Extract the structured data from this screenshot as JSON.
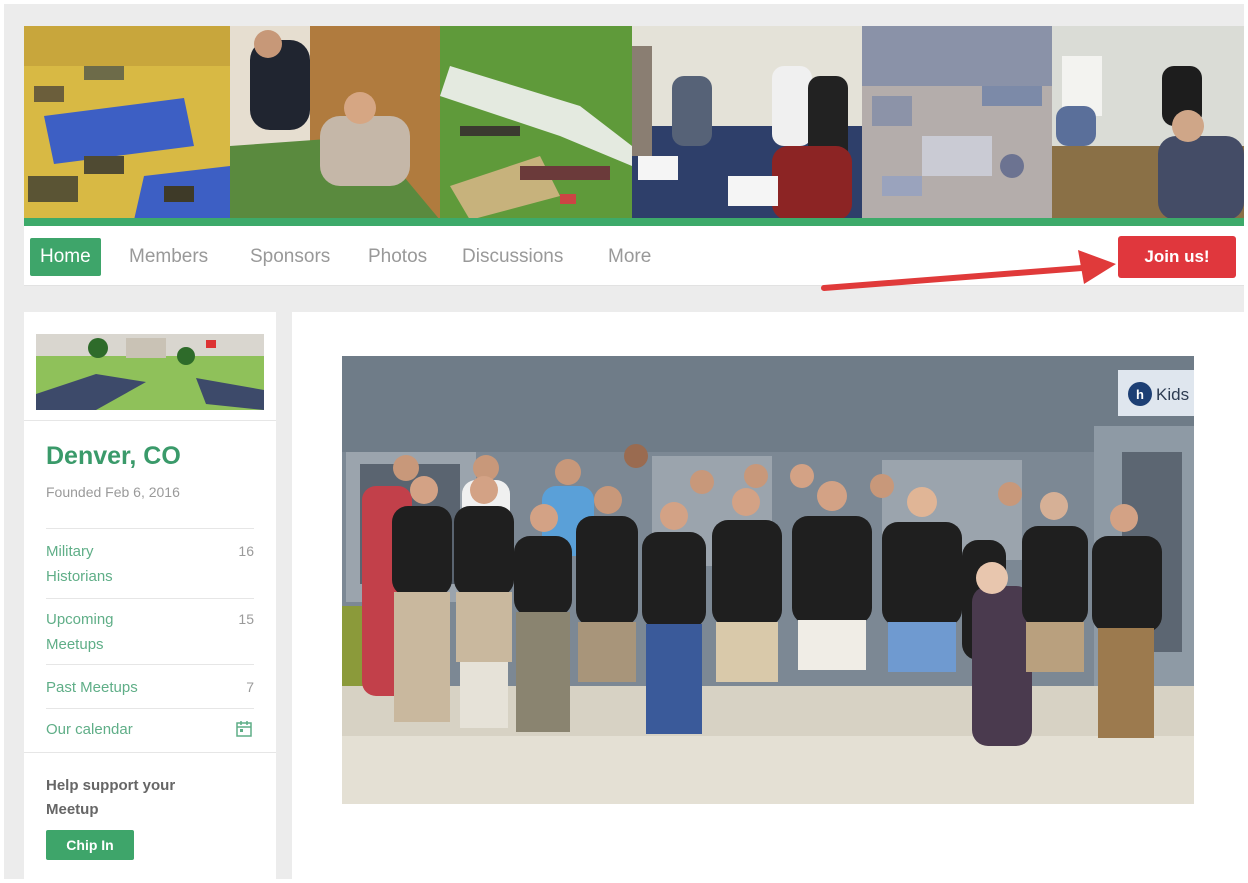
{
  "nav": {
    "items": [
      {
        "label": "Home",
        "active": true
      },
      {
        "label": "Members",
        "active": false
      },
      {
        "label": "Sponsors",
        "active": false
      },
      {
        "label": "Photos",
        "active": false
      },
      {
        "label": "Discussions",
        "active": false
      },
      {
        "label": "More",
        "active": false
      }
    ],
    "join_label": "Join us!"
  },
  "sidebar": {
    "city": "Denver, CO",
    "founded": "Founded Feb 6, 2016",
    "stats": [
      {
        "label": "Military Historians",
        "count": "16"
      },
      {
        "label": "Upcoming Meetups",
        "count": "15"
      },
      {
        "label": "Past Meetups",
        "count": "7"
      },
      {
        "label": "Our calendar",
        "icon": "calendar-icon"
      }
    ],
    "support_text": "Help support your Meetup",
    "chip_label": "Chip In"
  },
  "main": {
    "sign_text": "Kids"
  },
  "colors": {
    "brand_green": "#3ea56a",
    "join_red": "#e0373d",
    "link_green": "#5fae87",
    "annotation_arrow": "#e03a3a"
  }
}
